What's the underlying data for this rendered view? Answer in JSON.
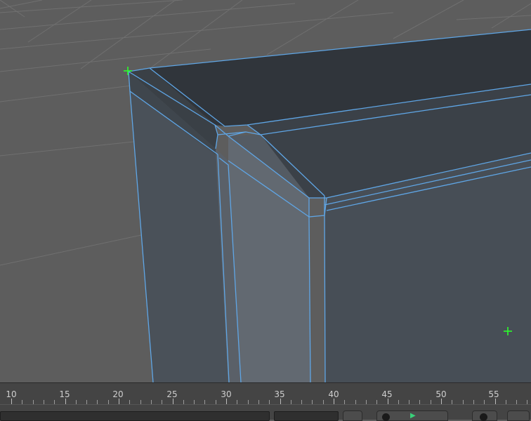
{
  "viewport": {
    "background_color": "#5d5d5d",
    "grid_color": "#6f6f6f",
    "mesh_face_color": "#434a52",
    "mesh_edge_color": "#5fa6e6",
    "vertex_marker_color": "#2bff2b",
    "markers": [
      "crosshair-marker-top-left",
      "crosshair-marker-lower-right"
    ]
  },
  "timeline": {
    "frame_labels": [
      "10",
      "15",
      "20",
      "25",
      "30",
      "35",
      "40",
      "45",
      "50",
      "55"
    ],
    "playhead_color": "#39d17a",
    "controls": [
      "range-field",
      "step-field",
      "record-button",
      "prev-frame-button",
      "play-button",
      "next-frame-button",
      "settings-button"
    ]
  }
}
